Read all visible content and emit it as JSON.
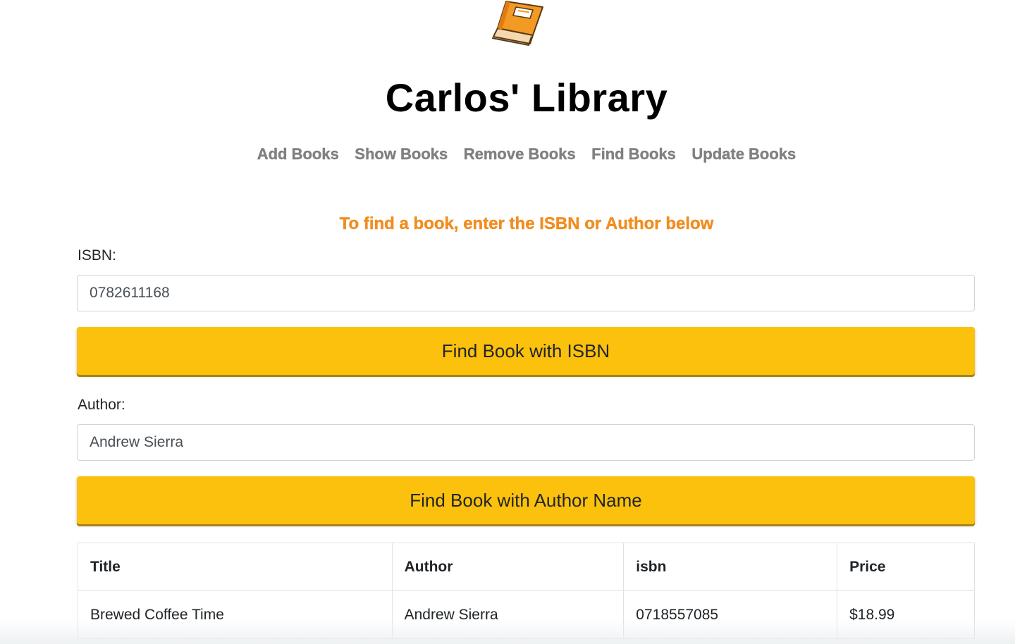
{
  "header": {
    "logo_icon": "orange-book-icon",
    "title": "Carlos' Library"
  },
  "nav": {
    "items": [
      {
        "label": "Add Books"
      },
      {
        "label": "Show Books"
      },
      {
        "label": "Remove Books"
      },
      {
        "label": "Find Books"
      },
      {
        "label": "Update Books"
      }
    ]
  },
  "find": {
    "instruction": "To find a book, enter the ISBN or Author below",
    "isbn_label": "ISBN:",
    "isbn_value": "0782611168",
    "isbn_button": "Find Book with ISBN",
    "author_label": "Author:",
    "author_value": "Andrew Sierra",
    "author_button": "Find Book with Author Name"
  },
  "results": {
    "columns": [
      "Title",
      "Author",
      "isbn",
      "Price"
    ],
    "rows": [
      [
        "Brewed Coffee Time",
        "Andrew Sierra",
        "0718557085",
        "$18.99"
      ]
    ]
  },
  "colors": {
    "accent_orange": "#f28c1e",
    "button_yellow": "#fcc10c",
    "nav_gray": "#808080"
  }
}
